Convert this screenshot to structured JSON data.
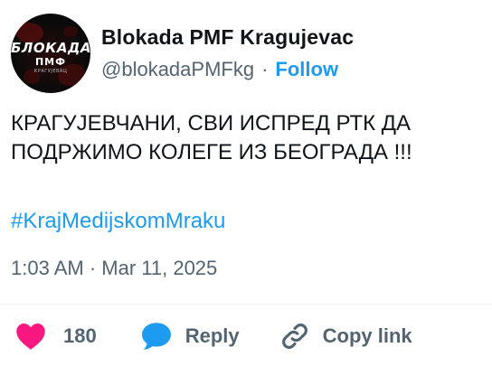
{
  "account": {
    "display_name": "Blokada PMF Kragujevac",
    "handle": "@blokadaPMFkg",
    "separator": "·",
    "follow_label": "Follow",
    "avatar_logo_top": "БЛОКАДА",
    "avatar_logo_mid": "ПМФ",
    "avatar_logo_small": "КРАГУЈЕВАЦ"
  },
  "tweet": {
    "text_line1": "КРАГУЈЕВЧАНИ, СВИ ИСПРЕД РТК ДА",
    "text_line2": "ПОДРЖИМО КОЛЕГЕ ИЗ БЕОГРАДА !!!",
    "hashtag": "#KrajMedijskomMraku",
    "timestamp": "1:03 AM · Mar 11, 2025"
  },
  "actions": {
    "like_count": "180",
    "reply_label": "Reply",
    "copy_link_label": "Copy link",
    "like_icon": "heart-icon",
    "reply_icon": "speech-bubble-icon",
    "copy_icon": "link-icon"
  },
  "colors": {
    "accent": "#1d9bf0",
    "like": "#f91880",
    "muted": "#536471",
    "text": "#0f1419"
  }
}
